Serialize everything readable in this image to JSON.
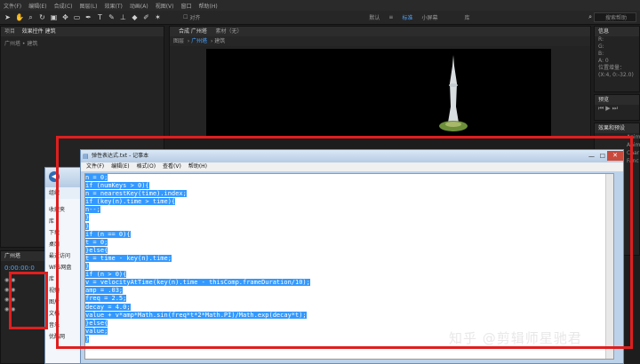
{
  "menubar": [
    "文件(F)",
    "编辑(E)",
    "合成(C)",
    "图层(L)",
    "效果(T)",
    "动画(A)",
    "视图(V)",
    "窗口",
    "帮助(H)"
  ],
  "toolbar": {
    "align_label": "对齐",
    "workspaces": [
      "默认",
      "标准",
      "小屏幕",
      "库"
    ],
    "active_workspace_index": 1,
    "search_placeholder": "搜索帮助"
  },
  "project_panel": {
    "tab_project": "项目",
    "tab_effects": "效果控件 建筑",
    "sub": "广州塔 • 建筑"
  },
  "composition_panel": {
    "tab": "合成 广州塔",
    "material": "素材（无）",
    "viewer_tabs": [
      "图层",
      "广州塔",
      "建筑"
    ]
  },
  "info_panel": {
    "title": "信息",
    "lines": [
      "R:",
      "G:",
      "B:",
      "A: 0"
    ],
    "pos_label": "位置增量：",
    "pos_value": "(X:4, 0:-32.0)"
  },
  "preview_panel": {
    "title": "预览"
  },
  "effects_panel": {
    "title": "效果和预设",
    "items": [
      "Anim",
      "Anim",
      "Char",
      "Fanc"
    ]
  },
  "timeline_panel": {
    "tab": "广州塔",
    "time": "0:00:00:0"
  },
  "explorer": {
    "items": [
      "组织",
      "收藏夹",
      "库",
      "下载",
      "桌面",
      "最近访问",
      "WPS网盘",
      "库",
      "视频",
      "图片",
      "文档",
      "音乐",
      "优酷网"
    ]
  },
  "notepad": {
    "title": "弹性表达式.txt - 记事本",
    "menu": [
      "文件(F)",
      "编辑(E)",
      "格式(O)",
      "查看(V)",
      "帮助(H)"
    ],
    "code": [
      "n = 0;",
      "if (numKeys > 0){",
      "n = nearestKey(time).index;",
      "if (key(n).time > time){",
      "n--;",
      "}",
      "}",
      "if (n == 0){",
      "t = 0;",
      "}else{",
      "t = time - key(n).time;",
      "}",
      "if (n > 0){",
      "v = velocityAtTime(key(n).time - thisComp.frameDuration/10);",
      "amp = .03;",
      "freq = 2.5;",
      "decay = 4.0;",
      "value + v*amp*Math.sin(freq*t*2*Math.PI)/Math.exp(decay*t);",
      "}else{",
      "value;",
      "}"
    ]
  },
  "watermark": "知乎 @剪辑师星驰君",
  "colors": {
    "annotation_red": "#e01e1e",
    "selection_blue": "#3399ff",
    "workspace_active": "#4aa3ff"
  }
}
